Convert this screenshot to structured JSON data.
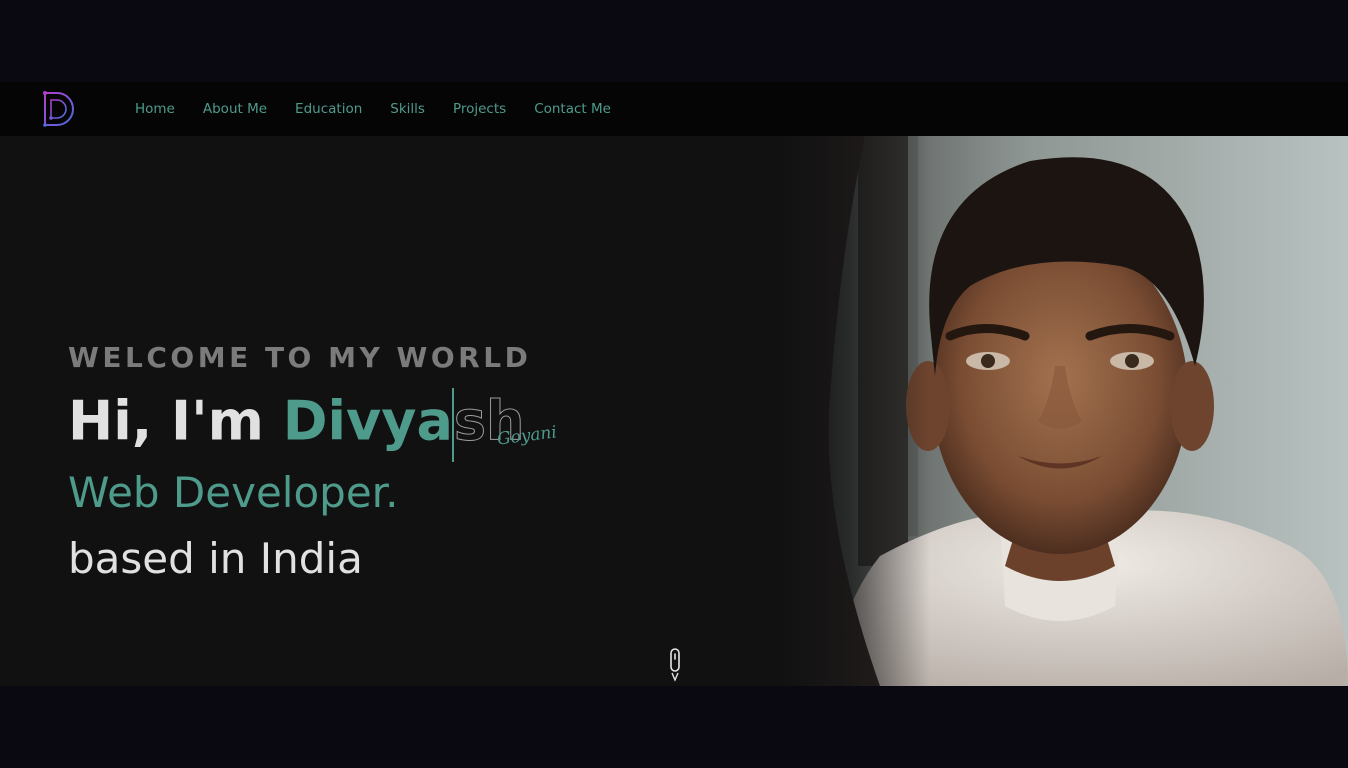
{
  "logo": {
    "letter": "D",
    "icon": "d-monogram-logo"
  },
  "nav": {
    "items": [
      {
        "label": "Home"
      },
      {
        "label": "About Me"
      },
      {
        "label": "Education"
      },
      {
        "label": "Skills"
      },
      {
        "label": "Projects"
      },
      {
        "label": "Contact Me"
      }
    ]
  },
  "hero": {
    "welcome": "WELCOME TO MY WORLD",
    "greeting_prefix": "Hi, I'm ",
    "name_typed": "Divya",
    "name_rest": "sh",
    "surname": "Goyani",
    "role": "Web Developer.",
    "location": "based in India",
    "scroll_icon": "mouse-scroll-icon"
  },
  "colors": {
    "accent": "#4e9a8b",
    "background": "#111112",
    "navbar": "#050506",
    "outer": "#0a0810",
    "text": "#e1e1e1",
    "muted": "#7b7b7b"
  }
}
